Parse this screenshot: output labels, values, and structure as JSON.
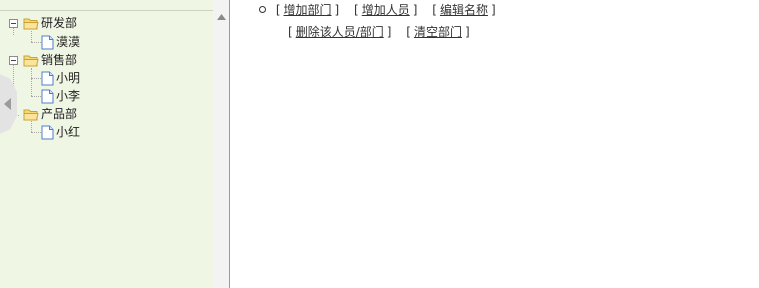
{
  "tree": {
    "nodes": [
      {
        "label": "研发部",
        "type": "folder",
        "expanded": true
      },
      {
        "label": "漠漠",
        "type": "leaf"
      },
      {
        "label": "销售部",
        "type": "folder",
        "expanded": true
      },
      {
        "label": "小明",
        "type": "leaf"
      },
      {
        "label": "小李",
        "type": "leaf"
      },
      {
        "label": "产品部",
        "type": "folder",
        "expanded": true
      },
      {
        "label": "小红",
        "type": "leaf"
      }
    ]
  },
  "actions": {
    "add_department": "增加部门",
    "add_person": "增加人员",
    "edit_name": "编辑名称",
    "delete_item": "删除该人员/部门",
    "clear_department": "清空部门"
  },
  "colors": {
    "tree_background": "#f0f6e4",
    "folder_icon": "#f3cf5a",
    "leaf_icon": "#4c7fc7"
  }
}
